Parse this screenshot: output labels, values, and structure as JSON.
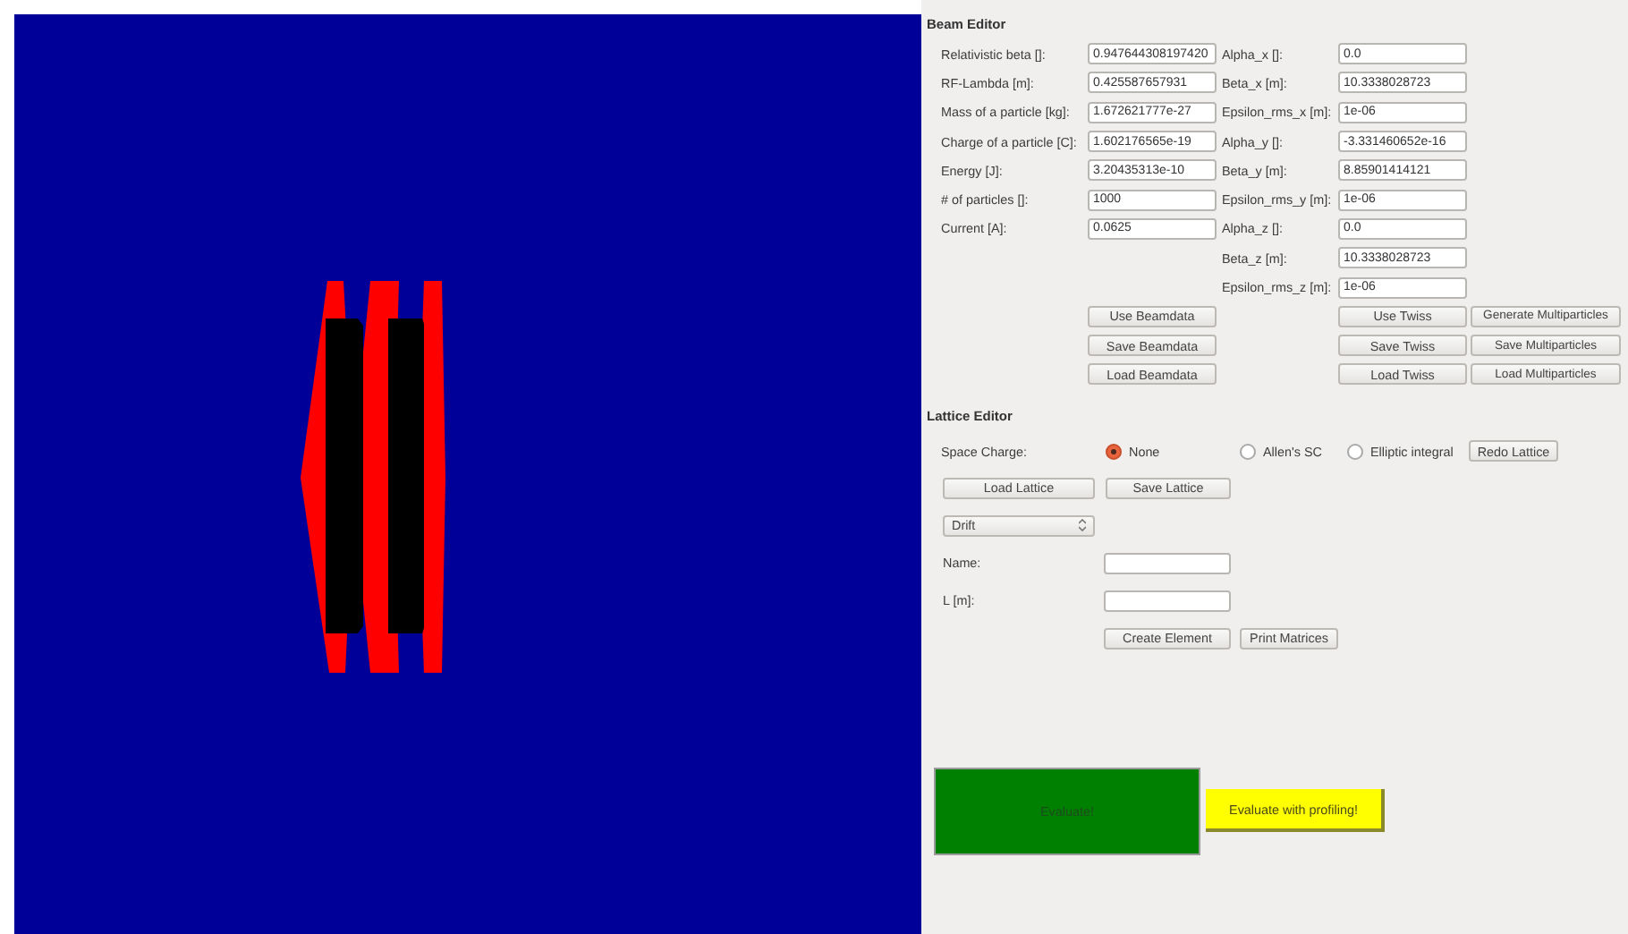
{
  "beam_editor": {
    "title": "Beam Editor",
    "beam_parameters": [
      {
        "label": "Relativistic beta []:",
        "value": "0.947644308197420"
      },
      {
        "label": "RF-Lambda [m]:",
        "value": "0.425587657931"
      },
      {
        "label": "Mass of a particle [kg]:",
        "value": "1.672621777e-27"
      },
      {
        "label": "Charge of a particle [C]:",
        "value": "1.602176565e-19"
      },
      {
        "label": "Energy [J]:",
        "value": "3.20435313e-10"
      },
      {
        "label": "# of particles []:",
        "value": "1000"
      },
      {
        "label": "Current [A]:",
        "value": "0.0625"
      }
    ],
    "twiss_parameters": [
      {
        "label": "Alpha_x []:",
        "value": "0.0"
      },
      {
        "label": "Beta_x [m]:",
        "value": "10.3338028723"
      },
      {
        "label": "Epsilon_rms_x [m]:",
        "value": "1e-06"
      },
      {
        "label": "Alpha_y []:",
        "value": "-3.331460652e-16"
      },
      {
        "label": "Beta_y [m]:",
        "value": "8.85901414121"
      },
      {
        "label": "Epsilon_rms_y [m]:",
        "value": "1e-06"
      },
      {
        "label": "Alpha_z []:",
        "value": "0.0"
      },
      {
        "label": "Beta_z [m]:",
        "value": "10.3338028723"
      },
      {
        "label": "Epsilon_rms_z [m]:",
        "value": "1e-06"
      }
    ],
    "beamdata_buttons": [
      "Use Beamdata",
      "Save Beamdata",
      "Load Beamdata"
    ],
    "twiss_buttons": [
      "Use Twiss",
      "Save Twiss",
      "Load Twiss"
    ],
    "multiparticle_buttons": [
      "Generate Multiparticles",
      "Save Multiparticles",
      "Load Multiparticles"
    ]
  },
  "lattice_editor": {
    "title": "Lattice Editor",
    "space_charge": {
      "label": "Space Charge:",
      "options": [
        {
          "label": "None",
          "selected": true
        },
        {
          "label": "Allen's SC",
          "selected": false
        },
        {
          "label": "Elliptic integral",
          "selected": false
        }
      ]
    },
    "redo_button": "Redo Lattice",
    "file_buttons": [
      "Load Lattice",
      "Save Lattice"
    ],
    "element_type": "Drift",
    "fields": [
      {
        "label": "Name:"
      },
      {
        "label": "L [m]:"
      }
    ],
    "action_buttons": [
      "Create Element",
      "Print Matrices"
    ]
  },
  "evaluate_button": "Evaluate!",
  "profile_button": "Evaluate with profiling!"
}
